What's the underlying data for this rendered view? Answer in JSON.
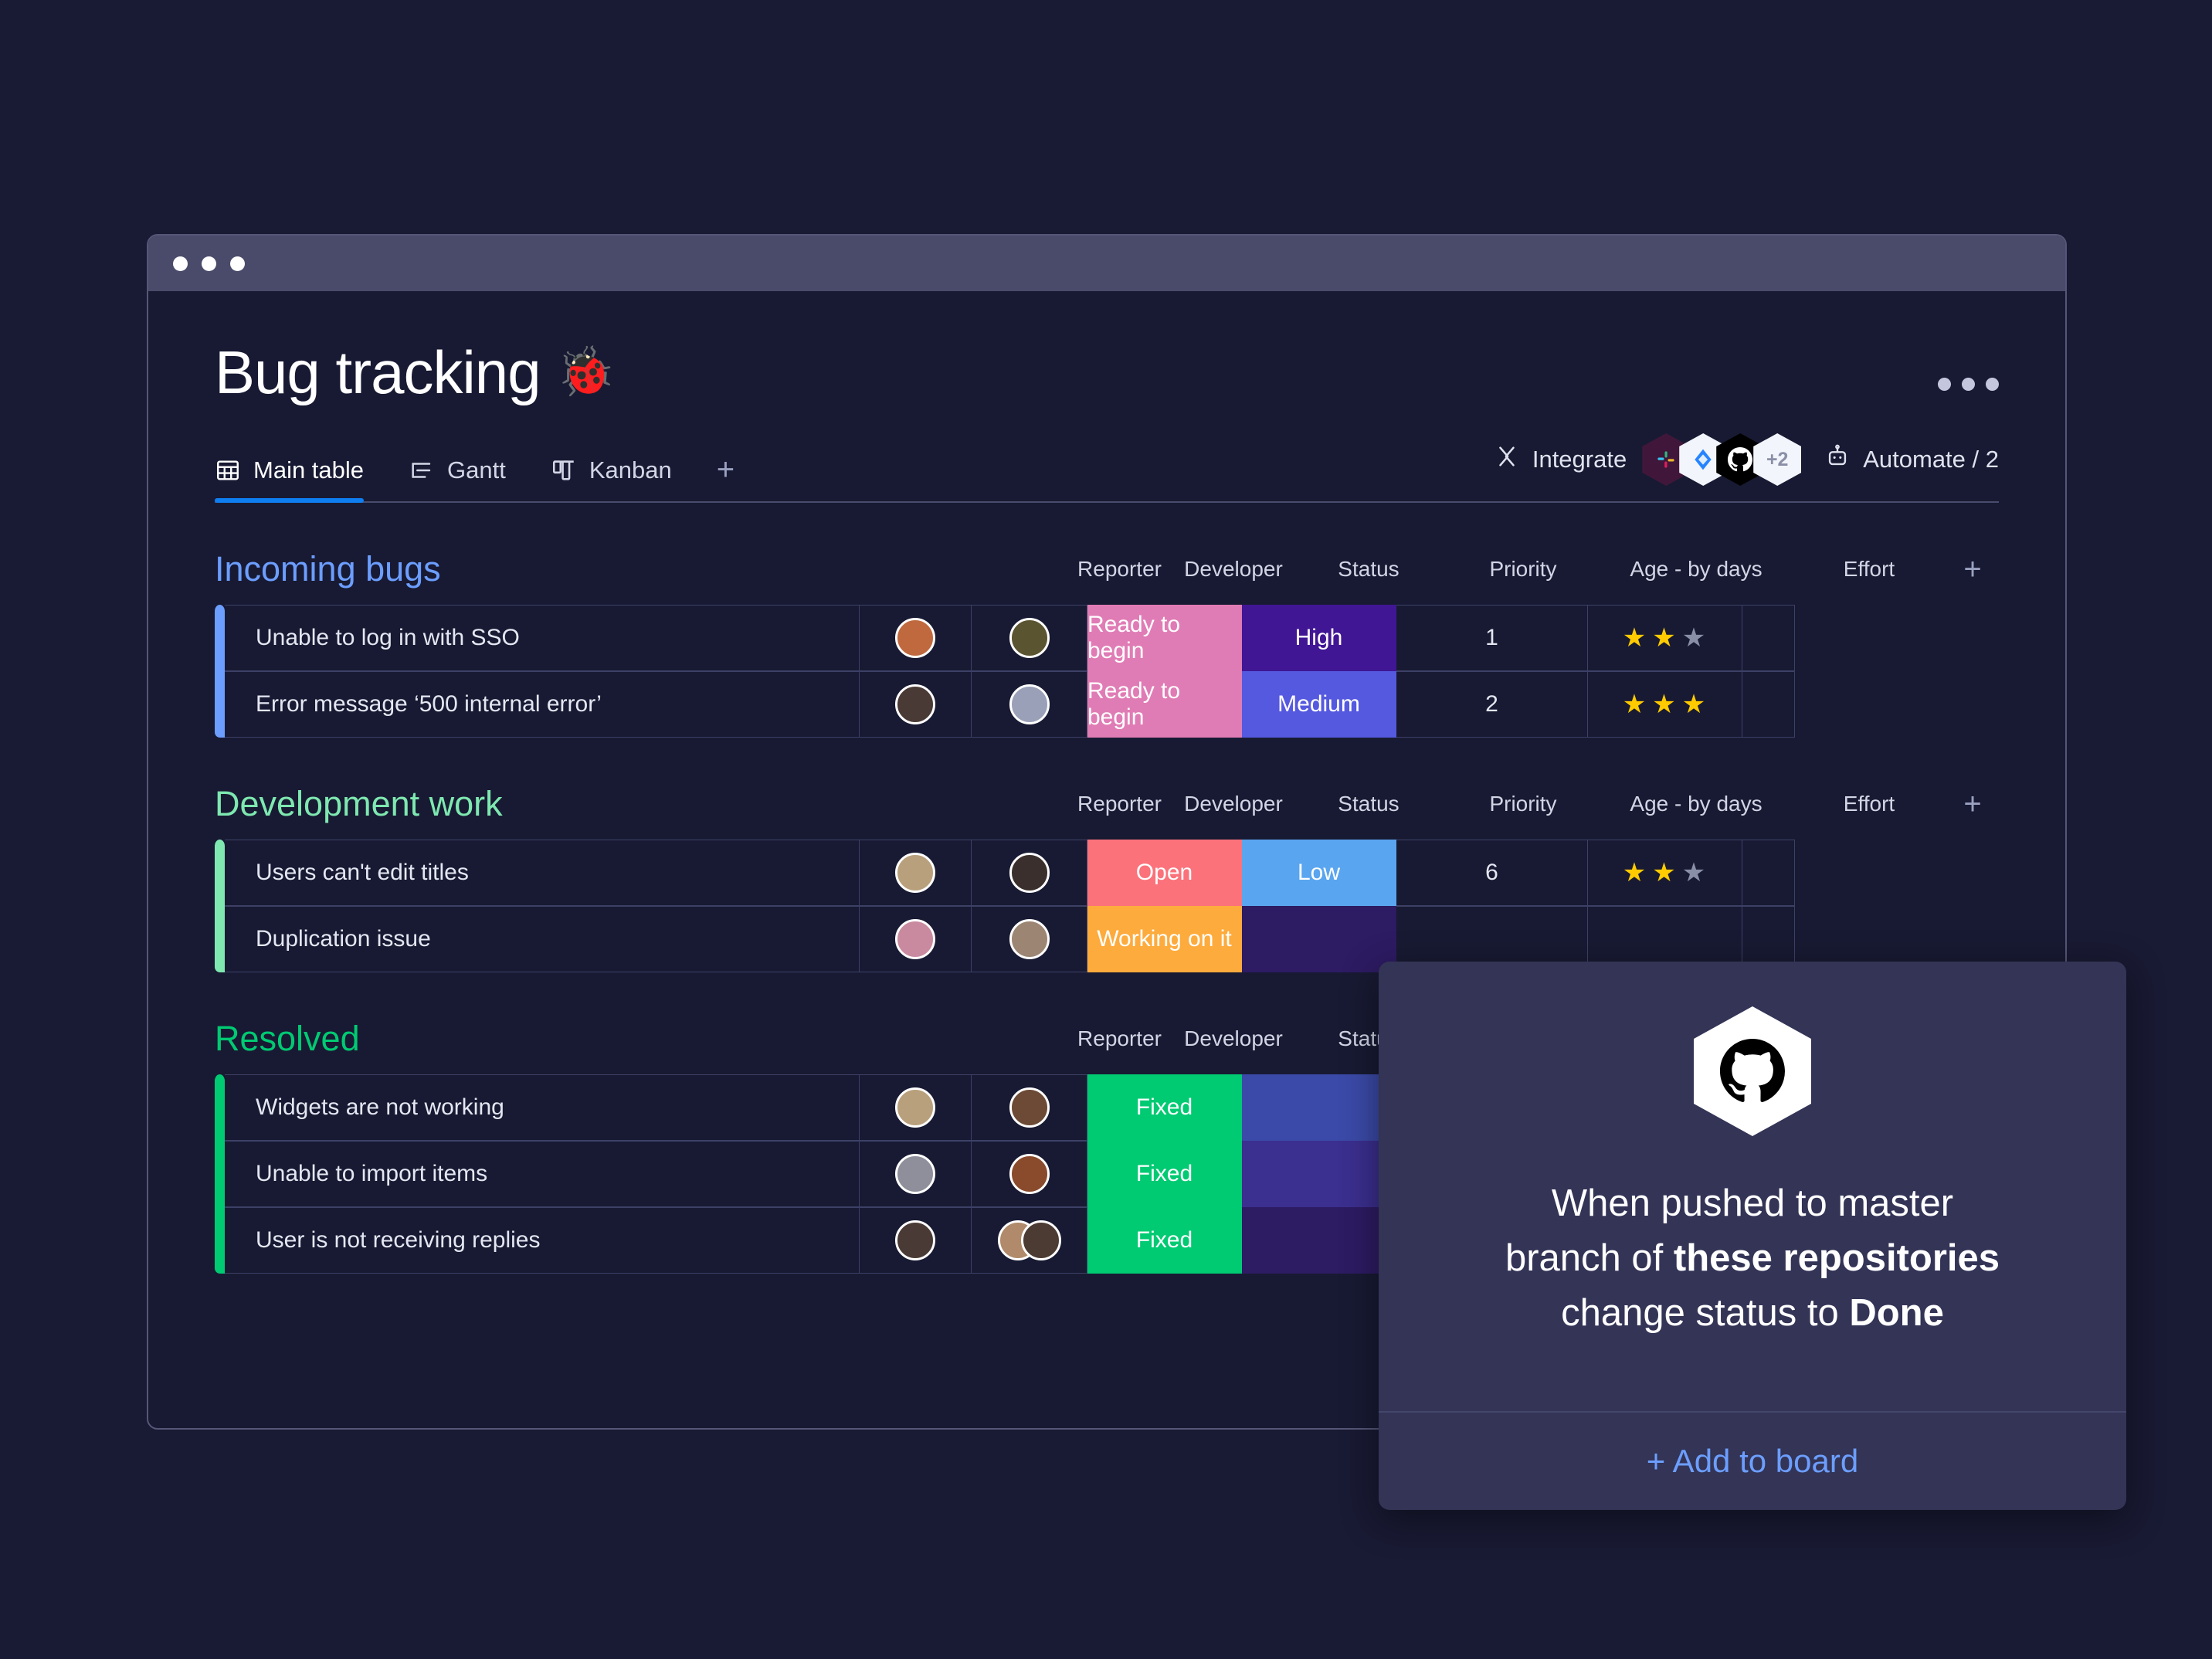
{
  "window": {
    "dots": [
      "close",
      "minimize",
      "maximize"
    ],
    "title": "Bug tracking",
    "title_emoji": "🐞",
    "menu_icon": "kebab-menu-icon"
  },
  "tabs": {
    "items": [
      {
        "label": "Main table",
        "icon": "table-icon",
        "active": true
      },
      {
        "label": "Gantt",
        "icon": "gantt-icon",
        "active": false
      },
      {
        "label": "Kanban",
        "icon": "kanban-icon",
        "active": false
      }
    ],
    "add_label": "+",
    "integrate": {
      "label": "Integrate",
      "icon": "integrate-icon",
      "badges": [
        "slack-icon",
        "jira-icon",
        "github-icon"
      ],
      "overflow_label": "+2"
    },
    "automate": {
      "label": "Automate / 2",
      "icon": "robot-icon"
    }
  },
  "columns": [
    "Reporter",
    "Developer",
    "Status",
    "Priority",
    "Age - by days",
    "Effort"
  ],
  "add_column_label": "+",
  "groups": [
    {
      "title": "Incoming bugs",
      "color": "#6c9eff",
      "rows": [
        {
          "name": "Unable to log in with SSO",
          "reporter": "avatar-asian-man",
          "developer": "avatar-woman-dark-hair",
          "status": "Ready to begin",
          "status_color": "#e07cb5",
          "priority": "High",
          "priority_color": "#401694",
          "age": "1",
          "effort_filled": 2,
          "effort_total": 3
        },
        {
          "name": "Error message ‘500 internal error’",
          "reporter": "avatar-woman-curly",
          "developer": "avatar-man-beard",
          "status": "Ready to begin",
          "status_color": "#e07cb5",
          "priority": "Medium",
          "priority_color": "#5559df",
          "age": "2",
          "effort_filled": 3,
          "effort_total": 3
        }
      ]
    },
    {
      "title": "Development work",
      "color": "#7ee8b0",
      "rows": [
        {
          "name": "Users can't edit titles",
          "reporter": "avatar-blonde-woman",
          "developer": "avatar-woman-long-hair",
          "status": "Open",
          "status_color": "#fb727b",
          "priority": "Low",
          "priority_color": "#5aa5ef",
          "age": "6",
          "effort_filled": 2,
          "effort_total": 3
        },
        {
          "name": "Duplication issue",
          "reporter": "avatar-woman-pink",
          "developer": "avatar-man-smiling",
          "status": "Working on it",
          "status_color": "#fdab3d",
          "priority": "",
          "priority_color": "#2d1b63",
          "age": "",
          "effort_filled": 0,
          "effort_total": 0
        }
      ]
    },
    {
      "title": "Resolved",
      "color": "#00ca72",
      "rows": [
        {
          "name": "Widgets are not working",
          "reporter": "avatar-blonde-woman",
          "developer": "avatar-man-glasses",
          "status": "Fixed",
          "status_color": "#00ca72",
          "priority": "",
          "priority_color": "#3b4aa8",
          "age": "",
          "effort_filled": 0,
          "effort_total": 0
        },
        {
          "name": "Unable to import items",
          "reporter": "avatar-man-bearded",
          "developer": "avatar-redhead-woman",
          "status": "Fixed",
          "status_color": "#00ca72",
          "priority": "",
          "priority_color": "#3b2f8f",
          "age": "",
          "effort_filled": 0,
          "effort_total": 0
        },
        {
          "name": "User is not receiving replies",
          "reporter": "avatar-woman-curly",
          "developer": "avatar-pair",
          "status": "Fixed",
          "status_color": "#00ca72",
          "priority": "",
          "priority_color": "#2d1b63",
          "age": "",
          "effort_filled": 0,
          "effort_total": 0
        }
      ]
    }
  ],
  "popup": {
    "icon": "github-icon",
    "line1": "When pushed to master",
    "line2_pre": "branch of ",
    "line2_bold": "these repositories",
    "line3_pre": "change status to ",
    "line3_bold": "Done",
    "cta_label": "+ Add to board"
  }
}
